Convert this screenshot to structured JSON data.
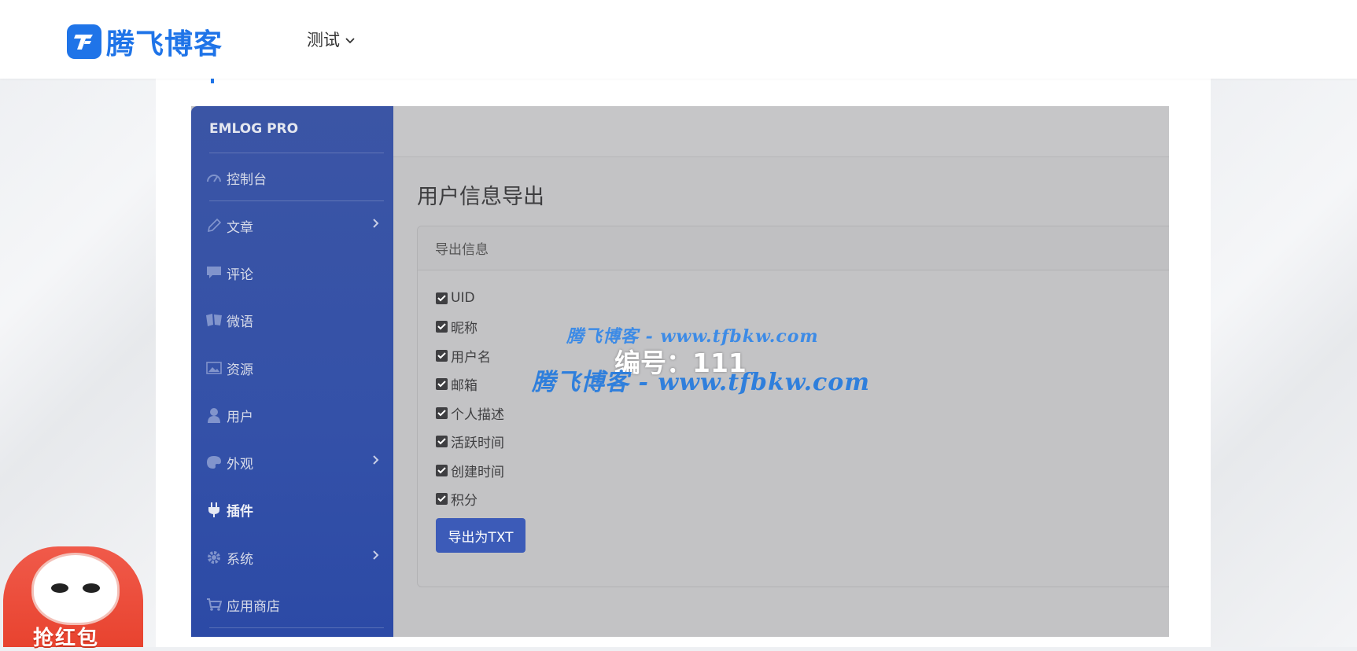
{
  "site": {
    "logo_text": "腾飞博客",
    "nav": {
      "label": "测试"
    }
  },
  "screenshot": {
    "sidebar": {
      "brand": "EMLOG PRO",
      "items": [
        {
          "label": "控制台",
          "icon": "dashboard-icon",
          "has_submenu": false
        },
        {
          "label": "文章",
          "icon": "pencil-icon",
          "has_submenu": true
        },
        {
          "label": "评论",
          "icon": "comment-icon",
          "has_submenu": false
        },
        {
          "label": "微语",
          "icon": "note-icon",
          "has_submenu": false
        },
        {
          "label": "资源",
          "icon": "image-icon",
          "has_submenu": false
        },
        {
          "label": "用户",
          "icon": "user-icon",
          "has_submenu": false
        },
        {
          "label": "外观",
          "icon": "palette-icon",
          "has_submenu": true
        },
        {
          "label": "插件",
          "icon": "plug-icon",
          "has_submenu": false,
          "active": true
        },
        {
          "label": "系统",
          "icon": "gear-icon",
          "has_submenu": true
        },
        {
          "label": "应用商店",
          "icon": "cart-icon",
          "has_submenu": false
        }
      ]
    },
    "page_title": "用户信息导出",
    "panel": {
      "header": "导出信息",
      "fields": [
        {
          "label": "UID",
          "checked": true
        },
        {
          "label": "昵称",
          "checked": true
        },
        {
          "label": "用户名",
          "checked": true
        },
        {
          "label": "邮箱",
          "checked": true
        },
        {
          "label": "个人描述",
          "checked": true
        },
        {
          "label": "活跃时间",
          "checked": true
        },
        {
          "label": "创建时间",
          "checked": true
        },
        {
          "label": "积分",
          "checked": true
        }
      ],
      "export_button": "导出为TXT"
    }
  },
  "watermarks": {
    "line1": "腾飞博客 - www.tfbkw.com",
    "line2": "腾飞博客 - www.tfbkw.com",
    "serial": "编号：111"
  },
  "promo": {
    "label": "抢红包"
  },
  "colors": {
    "brand_blue": "#1f74e8",
    "sidebar_blue": "#3451a8",
    "button_blue": "#3c5bb8",
    "promo_red": "#e8432f"
  }
}
